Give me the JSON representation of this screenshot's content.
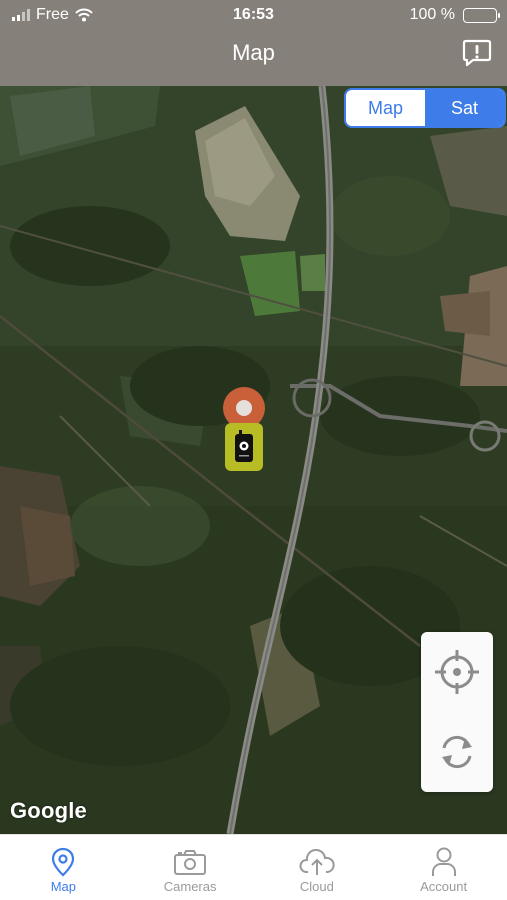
{
  "status_bar": {
    "carrier": "Free",
    "time": "16:53",
    "battery": "100 %",
    "battery_level": 1.0
  },
  "header": {
    "title": "Map",
    "alert_icon": "exclamation-bubble-icon"
  },
  "map": {
    "view_toggle": {
      "options": [
        "Map",
        "Sat"
      ],
      "selected": "Sat"
    },
    "attribution": "Google",
    "controls": [
      "crosshair-icon",
      "refresh-icon"
    ],
    "pin_icon": "location-pin-icon",
    "camera_marker_icon": "trail-camera-icon"
  },
  "tabs": [
    {
      "label": "Map",
      "icon": "map-pin-icon",
      "active": true
    },
    {
      "label": "Cameras",
      "icon": "camera-icon",
      "active": false
    },
    {
      "label": "Cloud",
      "icon": "cloud-upload-icon",
      "active": false
    },
    {
      "label": "Account",
      "icon": "person-icon",
      "active": false
    }
  ],
  "colors": {
    "header": "#86807a",
    "accent": "#3d7ce9",
    "pin": "#c9603a",
    "camera_marker": "#b8bd25"
  }
}
